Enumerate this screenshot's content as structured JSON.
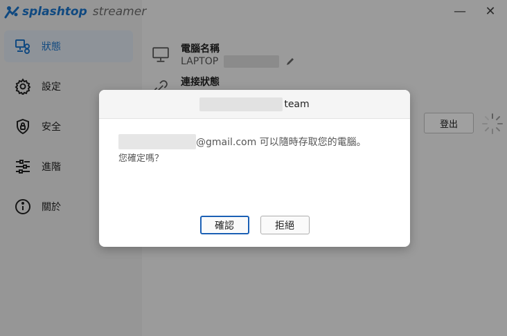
{
  "app": {
    "brand_name": "splashtop",
    "brand_product": "streamer",
    "window_controls": {
      "minimize": "—",
      "close": "✕"
    }
  },
  "sidebar": {
    "items": [
      {
        "label": "狀態",
        "icon": "monitor-link-icon",
        "active": true
      },
      {
        "label": "設定",
        "icon": "gear-icon",
        "active": false
      },
      {
        "label": "安全",
        "icon": "shield-lock-icon",
        "active": false
      },
      {
        "label": "進階",
        "icon": "sliders-icon",
        "active": false
      },
      {
        "label": "關於",
        "icon": "info-icon",
        "active": false
      }
    ]
  },
  "status": {
    "computer_name_label": "電腦名稱",
    "computer_name_value": "LAPTOP",
    "connection_status_label": "連接狀態",
    "logout_label": "登出"
  },
  "dialog": {
    "title": "team",
    "message_email_suffix": "@gmail.com 可以隨時存取您的電腦。",
    "message_question": "您確定嗎？",
    "confirm_label": "確認",
    "reject_label": "拒絕"
  },
  "colors": {
    "brand_blue": "#1a73c8",
    "active_nav_bg": "#dfe6f0",
    "primary_button_border": "#1a5fb4"
  }
}
